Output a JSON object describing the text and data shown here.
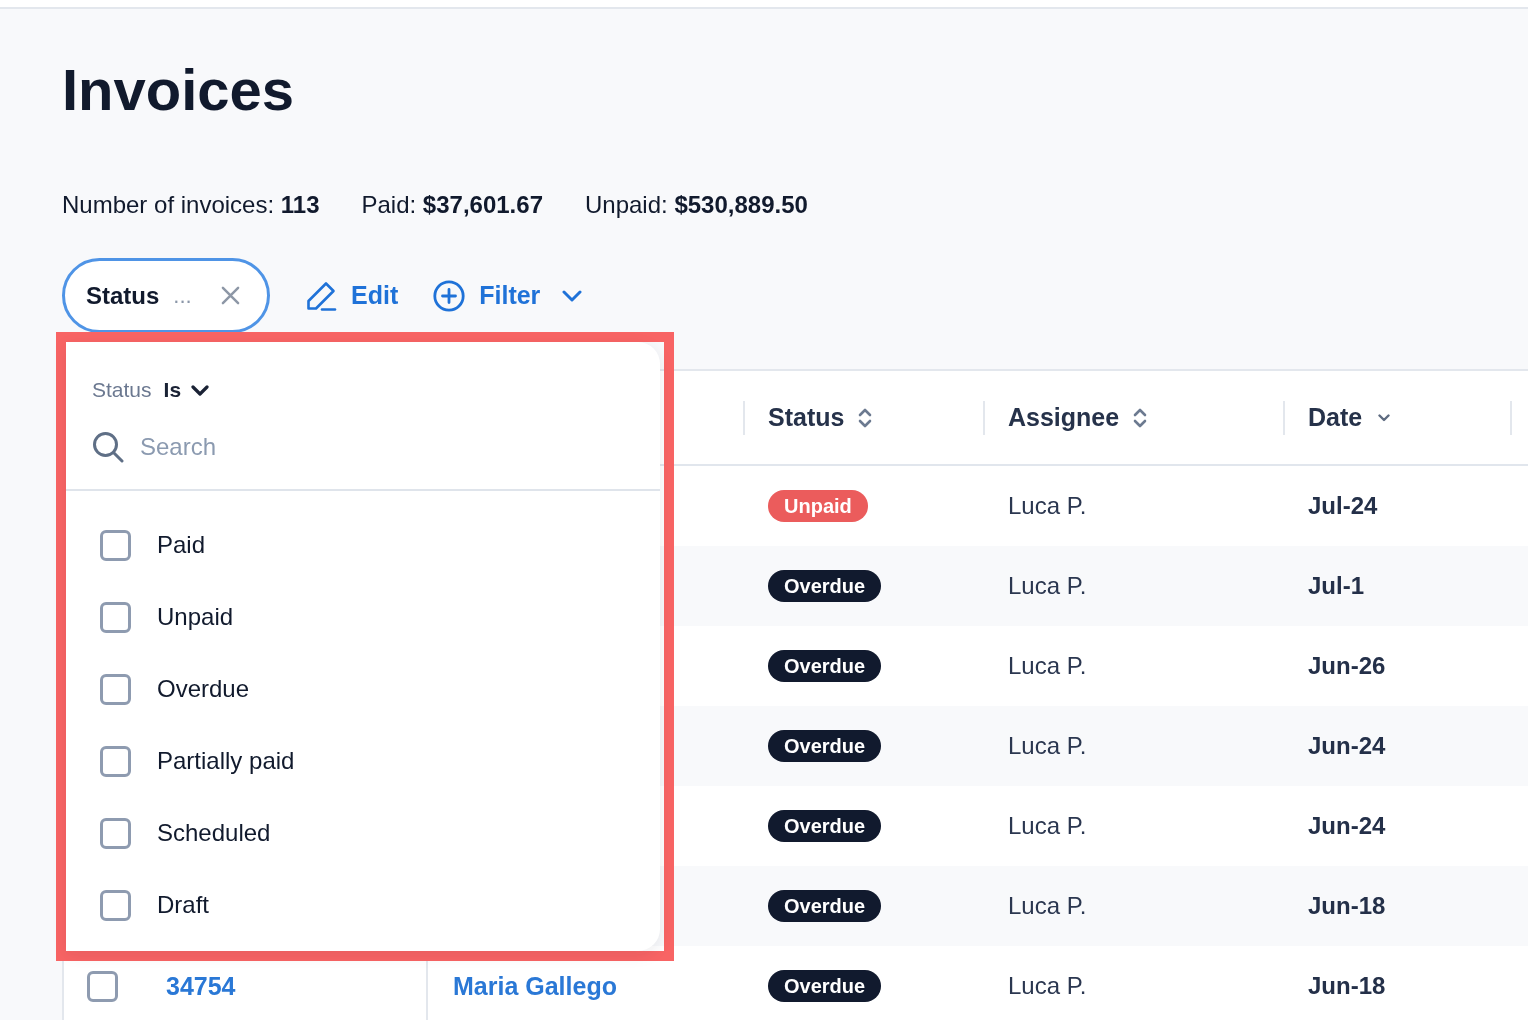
{
  "title": "Invoices",
  "summary": [
    "Number of invoices: **113**",
    "Paid: **$37,601.67**",
    "Unpaid: **$530,889.50**"
  ],
  "active_filter": {
    "label": "Status",
    "value": "..."
  },
  "actions": [
    {
      "kind": "edit",
      "label": "Edit"
    },
    {
      "kind": "filter",
      "label": "Filter"
    }
  ],
  "table": {
    "columns": [
      {
        "label": "Status",
        "kind": "sortable"
      },
      {
        "label": "Assignee",
        "kind": "sortable"
      },
      {
        "label": "Date",
        "kind": "sorted"
      }
    ],
    "rows": [
      {
        "status": {
          "label": "Unpaid",
          "color": "#eb5c5c"
        },
        "assignee": "Luca P.",
        "date": "Jul-24"
      },
      {
        "status": {
          "label": "Overdue",
          "color": "#111a2e"
        },
        "assignee": "Luca P.",
        "date": "Jul-1"
      },
      {
        "status": {
          "label": "Overdue",
          "color": "#111a2e"
        },
        "assignee": "Luca P.",
        "date": "Jun-26"
      },
      {
        "status": {
          "label": "Overdue",
          "color": "#111a2e"
        },
        "assignee": "Luca P.",
        "date": "Jun-24"
      },
      {
        "status": {
          "label": "Overdue",
          "color": "#111a2e"
        },
        "assignee": "Luca P.",
        "date": "Jun-24"
      },
      {
        "status": {
          "label": "Overdue",
          "color": "#111a2e"
        },
        "assignee": "Luca P.",
        "date": "Jun-18"
      },
      {
        "checked": false,
        "number": "34754",
        "customer": "Maria Gallego",
        "status": {
          "label": "Overdue",
          "color": "#111a2e"
        },
        "assignee": "Luca P.",
        "date": "Jun-18"
      }
    ]
  },
  "filter_dropdown": {
    "field": "Status",
    "operator": "Is",
    "search": {
      "placeholder": "Search"
    },
    "options": [
      {
        "label": "Paid",
        "checked": false
      },
      {
        "label": "Unpaid",
        "checked": false
      },
      {
        "label": "Overdue",
        "checked": false
      },
      {
        "label": "Partially paid",
        "checked": false
      },
      {
        "label": "Scheduled",
        "checked": false
      },
      {
        "label": "Draft",
        "checked": false
      }
    ]
  }
}
